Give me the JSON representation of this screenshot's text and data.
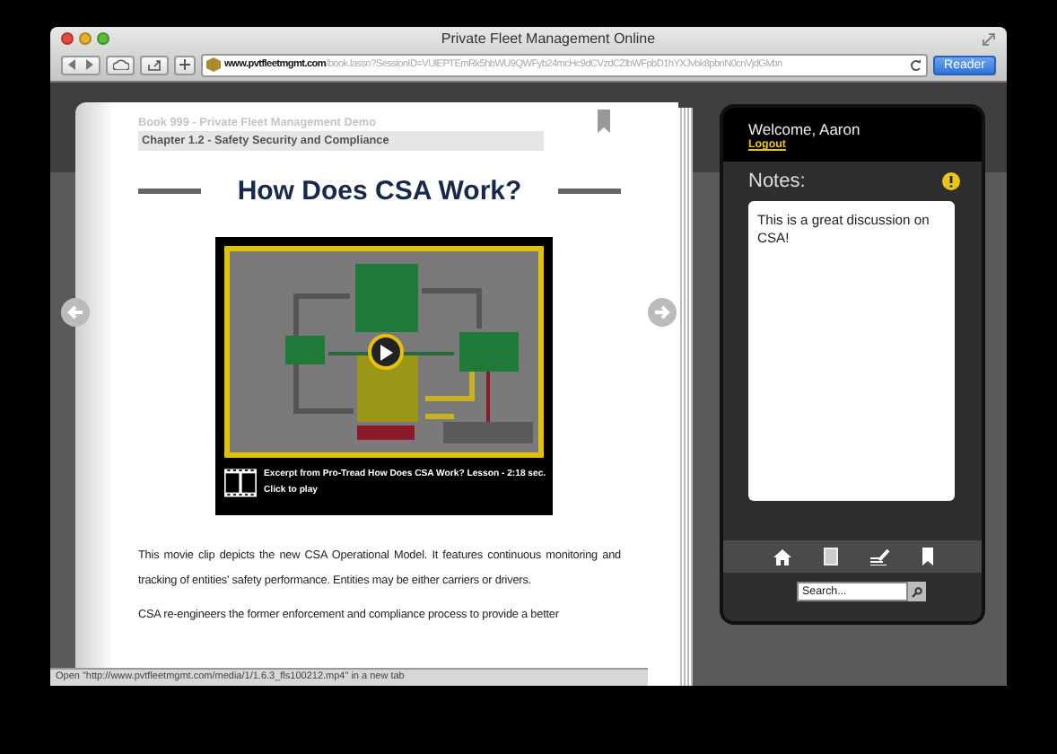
{
  "browser": {
    "title": "Private Fleet Management Online",
    "url_host": "www.pvtfleetmgmt.com",
    "url_path": "/book.lasso?SessionID=VUlEPTEmRk5hbWU9QWFyb24mcHc9dCVzdCZlbWFpbD1hYXJvbk8pbnN0cnVjdGlvbn",
    "reader_button": "Reader"
  },
  "book": {
    "book_label": "Book 999 - Private Fleet Management Demo",
    "chapter": "Chapter 1.2 - Safety Security and Compliance",
    "heading": "How Does CSA Work?",
    "video": {
      "kind": "picture",
      "caption": "Excerpt from Pro-Tread How Does CSA Work? Lesson - 2:18 sec.",
      "action": "Click to play"
    },
    "paragraphs": [
      "This movie clip depicts the new CSA Operational Model. It features continuous monitoring and tracking of entities' safety performance. Entities may be either carriers or drivers.",
      "CSA re-engineers the former enforcement and compliance process to provide a better"
    ]
  },
  "sidebar": {
    "welcome": "Welcome, Aaron",
    "logout": "Logout",
    "notes_label": "Notes:",
    "notes_text": "This is a great discussion on CSA!",
    "search": {
      "placeholder": "Search..."
    }
  },
  "status_bar": "Open \"http://www.pvtfleetmgmt.com/media/1/1.6.3_fls100212.mp4\" in a new tab"
}
